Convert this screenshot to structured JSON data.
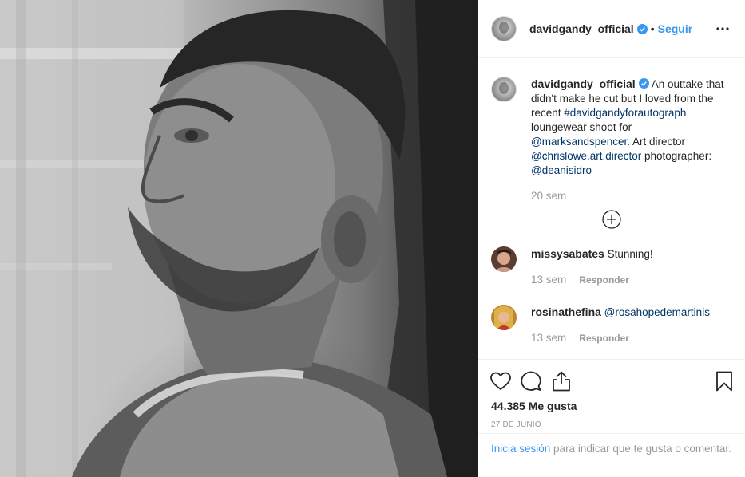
{
  "post": {
    "username": "davidgandy_official",
    "follow_separator": "•",
    "follow_label": "Seguir",
    "caption": {
      "username": "davidgandy_official",
      "text_1": " An outtake that didn't make he cut but I loved from the recent ",
      "hashtag": "#davidgandyforautograph",
      "text_2": " loungewear shoot for ",
      "mention_1": "@marksandspencer",
      "text_3": ". Art director ",
      "mention_2": "@chrislowe.art.director",
      "text_4": " photographer: ",
      "mention_3": "@deanisidro",
      "time": "20 sem"
    },
    "comments": [
      {
        "username": "missysabates",
        "text": "Stunning!",
        "time": "13 sem",
        "reply_label": "Responder"
      },
      {
        "username": "rosinathefina",
        "text": "@rosahopedemartinis",
        "time": "13 sem",
        "reply_label": "Responder"
      }
    ],
    "likes": "44.385 Me gusta",
    "date": "27 DE JUNIO",
    "login_prompt": {
      "link": "Inicia sesión",
      "text": " para indicar que te gusta o comentar."
    }
  },
  "icons": {
    "verified": "verified-badge-icon",
    "more": "more-options-icon",
    "load_more": "plus-circle-icon",
    "like": "heart-icon",
    "comment": "comment-icon",
    "share": "share-icon",
    "save": "bookmark-icon"
  },
  "colors": {
    "link_blue": "#3897f0",
    "mention_dark_blue": "#003569",
    "muted_gray": "#999999",
    "divider": "#efefef"
  }
}
